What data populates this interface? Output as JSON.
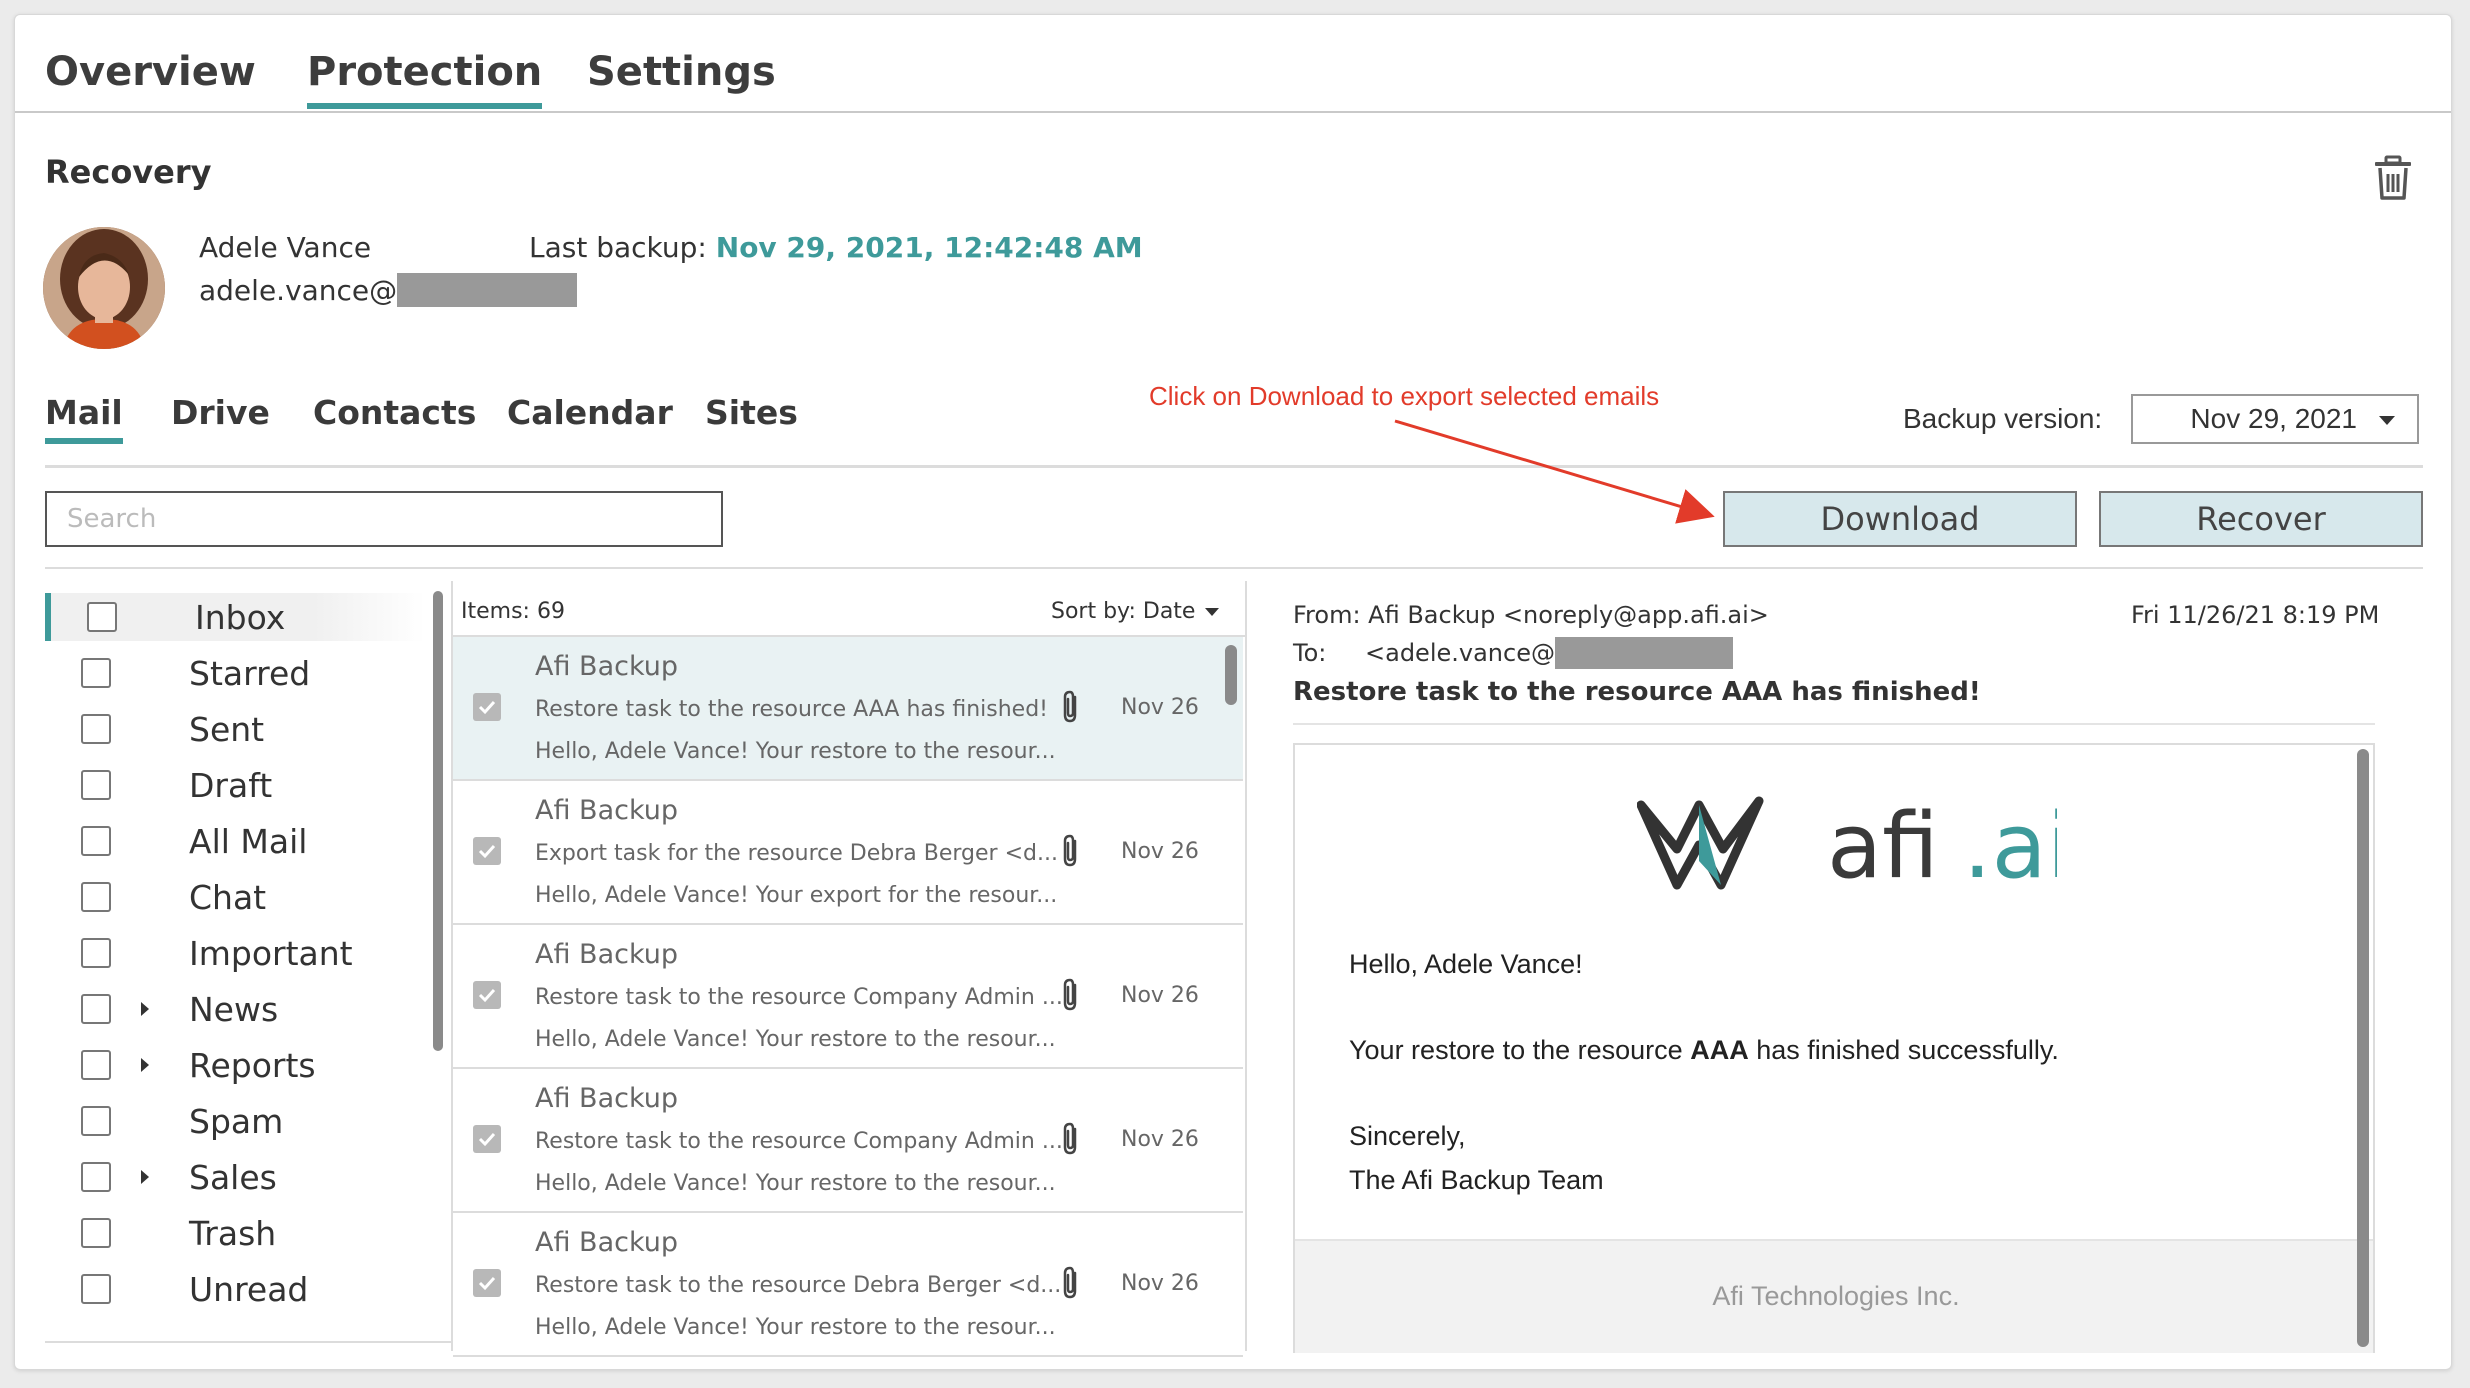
{
  "top_tabs": [
    "Overview",
    "Protection",
    "Settings"
  ],
  "page_title": "Recovery",
  "user": {
    "name": "Adele Vance",
    "email_prefix": "adele.vance@"
  },
  "last_backup": {
    "label": "Last backup:",
    "value": "Nov 29, 2021, 12:42:48 AM"
  },
  "sub_tabs": [
    "Mail",
    "Drive",
    "Contacts",
    "Calendar",
    "Sites"
  ],
  "annotation": "Click on Download to export selected emails",
  "backup_version": {
    "label": "Backup version:",
    "value": "Nov 29, 2021"
  },
  "search": {
    "placeholder": "Search"
  },
  "buttons": {
    "download": "Download",
    "recover": "Recover"
  },
  "folders": [
    {
      "label": "Inbox",
      "expandable": false
    },
    {
      "label": "Starred",
      "expandable": false
    },
    {
      "label": "Sent",
      "expandable": false
    },
    {
      "label": "Draft",
      "expandable": false
    },
    {
      "label": "All Mail",
      "expandable": false
    },
    {
      "label": "Chat",
      "expandable": false
    },
    {
      "label": "Important",
      "expandable": false
    },
    {
      "label": "News",
      "expandable": true
    },
    {
      "label": "Reports",
      "expandable": true
    },
    {
      "label": "Spam",
      "expandable": false
    },
    {
      "label": "Sales",
      "expandable": true
    },
    {
      "label": "Trash",
      "expandable": false
    },
    {
      "label": "Unread",
      "expandable": false
    }
  ],
  "message_list": {
    "items_count": "Items: 69",
    "sort_label": "Sort by: Date",
    "messages": [
      {
        "from": "Afi Backup",
        "subject": "Restore task to the resource AAA has finished!",
        "preview": "Hello, Adele Vance! Your restore to the resour...",
        "date": "Nov 26"
      },
      {
        "from": "Afi Backup",
        "subject": "Export task for the resource Debra Berger <d...",
        "preview": "Hello, Adele Vance! Your export for the resour...",
        "date": "Nov 26"
      },
      {
        "from": "Afi Backup",
        "subject": "Restore task to the resource Company Admin ...",
        "preview": "Hello, Adele Vance! Your restore to the resour...",
        "date": "Nov 26"
      },
      {
        "from": "Afi Backup",
        "subject": "Restore task to the resource Company Admin ...",
        "preview": "Hello, Adele Vance! Your restore to the resour...",
        "date": "Nov 26"
      },
      {
        "from": "Afi Backup",
        "subject": "Restore task to the resource Debra Berger <d...",
        "preview": "Hello, Adele Vance! Your restore to the resour...",
        "date": "Nov 26"
      }
    ]
  },
  "preview": {
    "from": "From: Afi Backup <noreply@app.afi.ai>",
    "date": "Fri 11/26/21 8:19 PM",
    "to_label": "To:",
    "to_prefix": "<adele.vance@",
    "subject": "Restore task to the resource AAA has finished!",
    "logo_text": "afi.ai",
    "greeting": "Hello, Adele Vance!",
    "body_pre": "Your restore to the resource ",
    "body_bold": "AAA",
    "body_post": " has finished successfully.",
    "sign1": "Sincerely,",
    "sign2": "The Afi Backup Team",
    "footer": "Afi Technologies Inc."
  },
  "colors": {
    "accent": "#3e9a9a",
    "annotation": "#e23b2a",
    "button_bg": "#d7e8ec"
  }
}
